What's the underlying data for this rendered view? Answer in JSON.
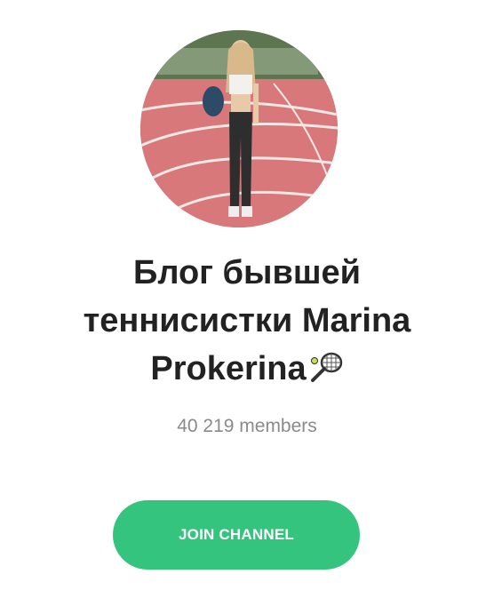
{
  "channel": {
    "title_line_1": "Блог бывшей",
    "title_line_2": "теннисистки Marina",
    "title_line_3": "Prokerina",
    "members": "40 219 members",
    "join_label": "JOIN CHANNEL"
  },
  "icons": {
    "title_emoji": "tennis-racket-icon"
  },
  "colors": {
    "button": "#35c47e",
    "track": "#d8787a",
    "title_text": "#222222",
    "members_text": "#8a8a8a"
  }
}
